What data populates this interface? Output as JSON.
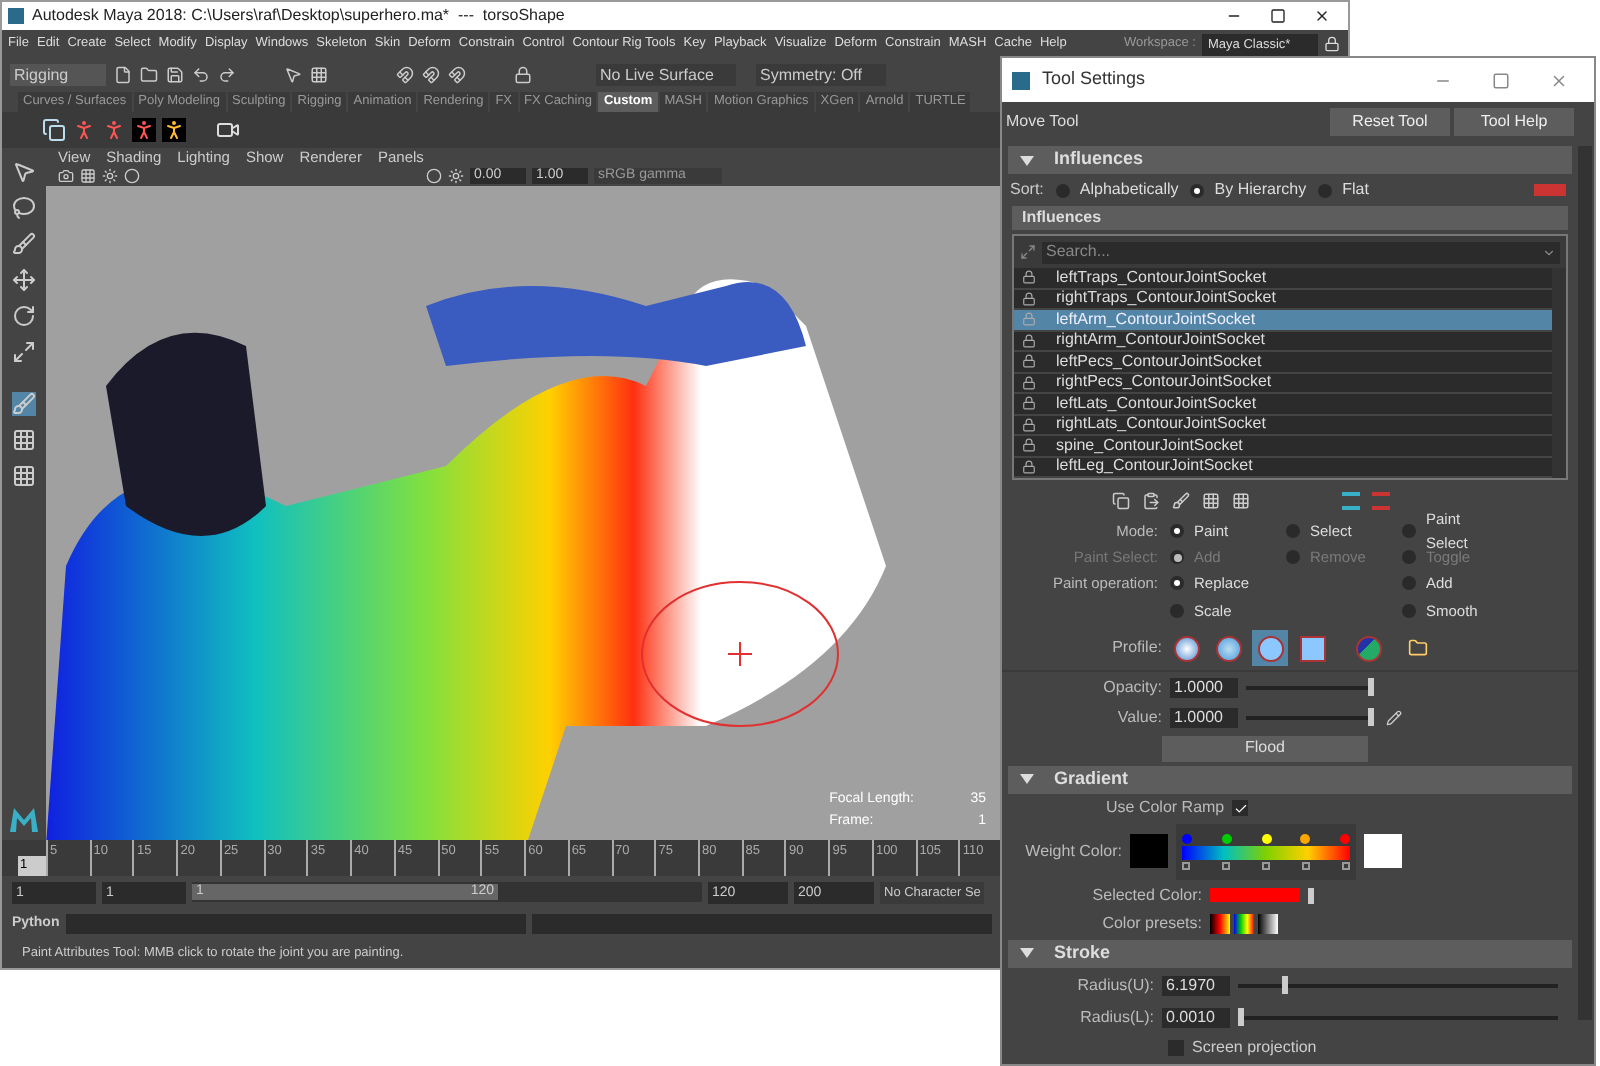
{
  "main_window": {
    "title": "Autodesk Maya 2018: C:\\Users\\raf\\Desktop\\superhero.ma*  ---  torsoShape",
    "menu": [
      "File",
      "Edit",
      "Create",
      "Select",
      "Modify",
      "Display",
      "Windows",
      "Skeleton",
      "Skin",
      "Deform",
      "Constrain",
      "Control",
      "Contour Rig Tools",
      "Key",
      "Playback",
      "Visualize",
      "Deform",
      "Constrain",
      "MASH",
      "Cache",
      "Help"
    ],
    "workspace": {
      "label": "Workspace :",
      "value": "Maya Classic*"
    },
    "menu_set": "Rigging",
    "live_surface": "No Live Surface",
    "symmetry": "Symmetry: Off",
    "shelf_tabs": [
      {
        "label": "Curves / Surfaces",
        "selected": false
      },
      {
        "label": "Poly Modeling",
        "selected": false
      },
      {
        "label": "Sculpting",
        "selected": false
      },
      {
        "label": "Rigging",
        "selected": false
      },
      {
        "label": "Animation",
        "selected": false
      },
      {
        "label": "Rendering",
        "selected": false
      },
      {
        "label": "FX",
        "selected": false
      },
      {
        "label": "FX Caching",
        "selected": false
      },
      {
        "label": "Custom",
        "selected": true
      },
      {
        "label": "MASH",
        "selected": false
      },
      {
        "label": "Motion Graphics",
        "selected": false
      },
      {
        "label": "XGen",
        "selected": false
      },
      {
        "label": "Arnold",
        "selected": false
      },
      {
        "label": "TURTLE",
        "selected": false
      }
    ],
    "viewport": {
      "menu": [
        "View",
        "Shading",
        "Lighting",
        "Show",
        "Renderer",
        "Panels"
      ],
      "exposure": "0.00",
      "gamma": "1.00",
      "color_space": "sRGB gamma",
      "hud": [
        {
          "label": "Focal Length:",
          "value": "35"
        },
        {
          "label": "Frame:",
          "value": "1"
        }
      ]
    },
    "timeline": {
      "current": "1",
      "ticks": [
        "5",
        "10",
        "15",
        "20",
        "25",
        "30",
        "35",
        "40",
        "45",
        "50",
        "55",
        "60",
        "65",
        "70",
        "75",
        "80",
        "85",
        "90",
        "95",
        "100",
        "105",
        "110"
      ]
    },
    "range": {
      "start": "1",
      "inner_start": "1",
      "slider_start": "1",
      "slider_end": "120",
      "inner_end": "120",
      "end": "200",
      "level": 0.6,
      "character_set": "No Character Se"
    },
    "command_line": {
      "language": "Python"
    },
    "status": "Paint Attributes Tool: MMB click to rotate the joint you are painting."
  },
  "tool_settings": {
    "title": "Tool Settings",
    "tool": "Move Tool",
    "buttons": [
      "Reset Tool",
      "Tool Help"
    ],
    "influences": {
      "header": "Influences",
      "expanded": true,
      "sort_label": "Sort:",
      "sort": [
        {
          "label": "Alphabetically",
          "selected": false
        },
        {
          "label": "By Hierarchy",
          "selected": true
        },
        {
          "label": "Flat",
          "selected": false
        }
      ],
      "list_header": "Influences",
      "search_placeholder": "Search...",
      "items": [
        {
          "label": "leftTraps_ContourJointSocket",
          "selected": false
        },
        {
          "label": "rightTraps_ContourJointSocket",
          "selected": false
        },
        {
          "label": "leftArm_ContourJointSocket",
          "selected": true
        },
        {
          "label": "rightArm_ContourJointSocket",
          "selected": false
        },
        {
          "label": "leftPecs_ContourJointSocket",
          "selected": false
        },
        {
          "label": "rightPecs_ContourJointSocket",
          "selected": false
        },
        {
          "label": "leftLats_ContourJointSocket",
          "selected": false
        },
        {
          "label": "rightLats_ContourJointSocket",
          "selected": false
        },
        {
          "label": "spine_ContourJointSocket",
          "selected": false
        },
        {
          "label": "leftLeg_ContourJointSocket",
          "selected": false
        }
      ],
      "mode": {
        "label": "Mode:",
        "disabled": false,
        "options": [
          {
            "label": "Paint",
            "selected": true
          },
          {
            "label": "Select",
            "selected": false
          },
          {
            "label": "Paint Select",
            "selected": false
          }
        ]
      },
      "paint_select": {
        "label": "Paint Select:",
        "disabled": true,
        "options": [
          {
            "label": "Add",
            "selected": true
          },
          {
            "label": "Remove",
            "selected": false
          },
          {
            "label": "Toggle",
            "selected": false
          }
        ]
      },
      "paint_operation": {
        "label": "Paint operation:",
        "options": [
          {
            "label": "Replace",
            "selected": true
          },
          {
            "label": "Add",
            "selected": false
          },
          {
            "label": "Scale",
            "selected": false
          },
          {
            "label": "Smooth",
            "selected": false
          }
        ]
      },
      "profile": {
        "label": "Profile:",
        "brushes": [
          {
            "kind": "gaussian",
            "selected": false
          },
          {
            "kind": "soft",
            "selected": false
          },
          {
            "kind": "solid",
            "selected": true
          },
          {
            "kind": "square",
            "selected": false
          }
        ]
      },
      "opacity": {
        "label": "Opacity:",
        "value": "1.0000",
        "level": 1
      },
      "value": {
        "label": "Value:",
        "value": "1.0000",
        "level": 1
      },
      "flood": "Flood"
    },
    "gradient": {
      "header": "Gradient",
      "expanded": true,
      "use_color_ramp": {
        "label": "Use Color Ramp",
        "checked": true
      },
      "weight_color": {
        "label": "Weight Color:",
        "stops": [
          {
            "color": "#0000ff"
          },
          {
            "color": "#00cc00"
          },
          {
            "color": "#ffff00"
          },
          {
            "color": "#ffa500"
          },
          {
            "color": "#ff0000"
          }
        ]
      },
      "selected_color": {
        "label": "Selected Color:",
        "color": "#ff0000"
      },
      "color_presets": {
        "label": "Color presets:"
      }
    },
    "stroke": {
      "header": "Stroke",
      "expanded": true,
      "radius_u": {
        "label": "Radius(U):",
        "value": "6.1970",
        "level": 0.14
      },
      "radius_l": {
        "label": "Radius(L):",
        "value": "0.0010",
        "level": 0
      },
      "screen_projection": {
        "label": "Screen projection",
        "checked": false
      }
    }
  }
}
